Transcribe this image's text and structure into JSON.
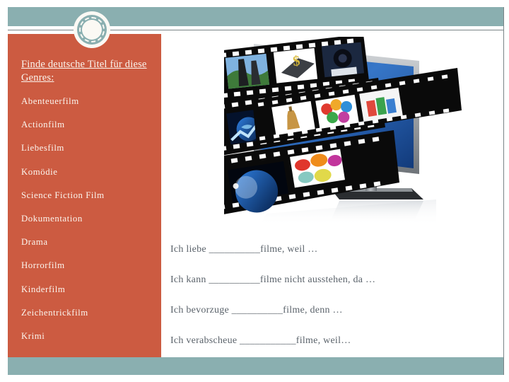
{
  "slide": {
    "background_color": "#ffffff",
    "accent_teal": "#8AAFB0",
    "accent_red": "#CC5B41",
    "rule_color": "#7a8487",
    "body_text_color": "#5b636b",
    "sidebar_text_color": "#fbf5ee"
  },
  "header": {
    "decor_icon": "ring-circle-decoration",
    "band_label": ""
  },
  "sidebar": {
    "title": "Finde deutsche Titel für diese Genres:",
    "genres": [
      {
        "label": "Abenteuerfilm"
      },
      {
        "label": "Actionfilm"
      },
      {
        "label": "Liebesfilm"
      },
      {
        "label": "Komödie"
      },
      {
        "label": "Science Fiction Film"
      },
      {
        "label": "Dokumentation"
      },
      {
        "label": "Drama"
      },
      {
        "label": "Horrorfilm"
      },
      {
        "label": "Kinderfilm"
      },
      {
        "label": "Zeichentrickfilm"
      },
      {
        "label": "Krimi"
      }
    ]
  },
  "main": {
    "image": {
      "name": "filmstrips-and-monitor-illustration",
      "alt": "Three film strips of photo frames streaming out of a widescreen computer monitor"
    },
    "prompts": [
      {
        "text": "Ich liebe __________filme, weil …"
      },
      {
        "text": "Ich kann __________filme nicht ausstehen, da …"
      },
      {
        "text": "Ich bevorzuge __________filme, denn …"
      },
      {
        "text": "Ich verabscheue ___________filme, weil…"
      }
    ]
  }
}
